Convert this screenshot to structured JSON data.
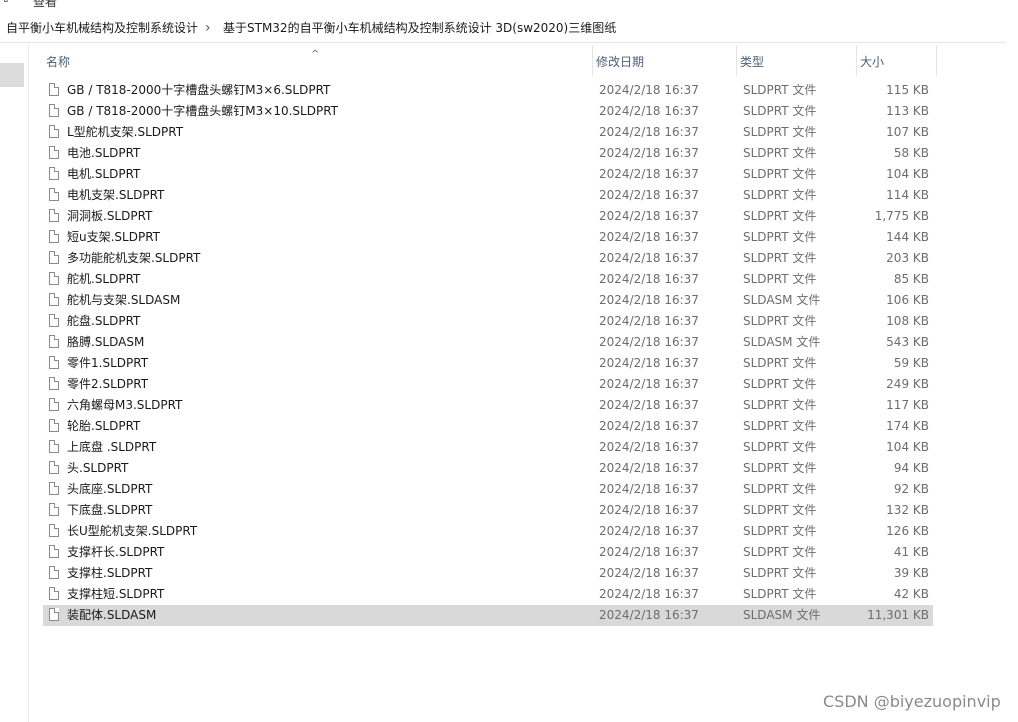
{
  "menu": {
    "partial_label": "查看"
  },
  "breadcrumb": {
    "items": [
      "自平衡小车机械结构及控制系统设计",
      "基于STM32的自平衡小车机械结构及控制系统设计 3D(sw2020)三维图纸"
    ],
    "separator": "›"
  },
  "columns": {
    "name": "名称",
    "date": "修改日期",
    "type": "类型",
    "size": "大小"
  },
  "files": [
    {
      "name": "GB / T818-2000十字槽盘头螺钉M3×6.SLDPRT",
      "date": "2024/2/18 16:37",
      "type": "SLDPRT 文件",
      "size": "115 KB"
    },
    {
      "name": "GB / T818-2000十字槽盘头螺钉M3×10.SLDPRT",
      "date": "2024/2/18 16:37",
      "type": "SLDPRT 文件",
      "size": "113 KB"
    },
    {
      "name": "L型舵机支架.SLDPRT",
      "date": "2024/2/18 16:37",
      "type": "SLDPRT 文件",
      "size": "107 KB"
    },
    {
      "name": "电池.SLDPRT",
      "date": "2024/2/18 16:37",
      "type": "SLDPRT 文件",
      "size": "58 KB"
    },
    {
      "name": "电机.SLDPRT",
      "date": "2024/2/18 16:37",
      "type": "SLDPRT 文件",
      "size": "104 KB"
    },
    {
      "name": "电机支架.SLDPRT",
      "date": "2024/2/18 16:37",
      "type": "SLDPRT 文件",
      "size": "114 KB"
    },
    {
      "name": "洞洞板.SLDPRT",
      "date": "2024/2/18 16:37",
      "type": "SLDPRT 文件",
      "size": "1,775 KB"
    },
    {
      "name": "短u支架.SLDPRT",
      "date": "2024/2/18 16:37",
      "type": "SLDPRT 文件",
      "size": "144 KB"
    },
    {
      "name": "多功能舵机支架.SLDPRT",
      "date": "2024/2/18 16:37",
      "type": "SLDPRT 文件",
      "size": "203 KB"
    },
    {
      "name": "舵机.SLDPRT",
      "date": "2024/2/18 16:37",
      "type": "SLDPRT 文件",
      "size": "85 KB"
    },
    {
      "name": "舵机与支架.SLDASM",
      "date": "2024/2/18 16:37",
      "type": "SLDASM 文件",
      "size": "106 KB"
    },
    {
      "name": "舵盘.SLDPRT",
      "date": "2024/2/18 16:37",
      "type": "SLDPRT 文件",
      "size": "108 KB"
    },
    {
      "name": "胳膊.SLDASM",
      "date": "2024/2/18 16:37",
      "type": "SLDASM 文件",
      "size": "543 KB"
    },
    {
      "name": "零件1.SLDPRT",
      "date": "2024/2/18 16:37",
      "type": "SLDPRT 文件",
      "size": "59 KB"
    },
    {
      "name": "零件2.SLDPRT",
      "date": "2024/2/18 16:37",
      "type": "SLDPRT 文件",
      "size": "249 KB"
    },
    {
      "name": "六角螺母M3.SLDPRT",
      "date": "2024/2/18 16:37",
      "type": "SLDPRT 文件",
      "size": "117 KB"
    },
    {
      "name": "轮胎.SLDPRT",
      "date": "2024/2/18 16:37",
      "type": "SLDPRT 文件",
      "size": "174 KB"
    },
    {
      "name": "上底盘 .SLDPRT",
      "date": "2024/2/18 16:37",
      "type": "SLDPRT 文件",
      "size": "104 KB"
    },
    {
      "name": "头.SLDPRT",
      "date": "2024/2/18 16:37",
      "type": "SLDPRT 文件",
      "size": "94 KB"
    },
    {
      "name": "头底座.SLDPRT",
      "date": "2024/2/18 16:37",
      "type": "SLDPRT 文件",
      "size": "92 KB"
    },
    {
      "name": "下底盘.SLDPRT",
      "date": "2024/2/18 16:37",
      "type": "SLDPRT 文件",
      "size": "132 KB"
    },
    {
      "name": "长U型舵机支架.SLDPRT",
      "date": "2024/2/18 16:37",
      "type": "SLDPRT 文件",
      "size": "126 KB"
    },
    {
      "name": "支撑杆长.SLDPRT",
      "date": "2024/2/18 16:37",
      "type": "SLDPRT 文件",
      "size": "41 KB"
    },
    {
      "name": "支撑柱.SLDPRT",
      "date": "2024/2/18 16:37",
      "type": "SLDPRT 文件",
      "size": "39 KB"
    },
    {
      "name": "支撑柱短.SLDPRT",
      "date": "2024/2/18 16:37",
      "type": "SLDPRT 文件",
      "size": "42 KB"
    },
    {
      "name": "装配体.SLDASM",
      "date": "2024/2/18 16:37",
      "type": "SLDASM 文件",
      "size": "11,301 KB",
      "selected": true
    }
  ],
  "watermark": "CSDN @biyezuopinvip",
  "icons": {
    "file": "file-icon",
    "sort": "sort-ascending-icon",
    "breadcrumb_separator": "chevron-right-icon"
  },
  "colors": {
    "selection": "#d9d9d9",
    "header_text": "#4c607a",
    "secondary_text": "#6d6d6d"
  }
}
